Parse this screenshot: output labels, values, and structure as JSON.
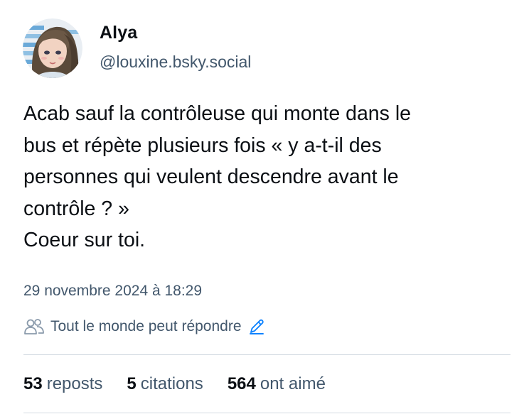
{
  "author": {
    "display_name": "Alya",
    "handle": "@louxine.bsky.social"
  },
  "post": {
    "lines": [
      "Acab sauf la contrôleuse qui monte dans le",
      "bus et répète plusieurs fois « y a-t-il des",
      "personnes qui veulent descendre avant le",
      "contrôle ? »",
      "Coeur sur toi."
    ],
    "timestamp": "29 novembre 2024 à 18:29",
    "reply_setting": "Tout le monde peut répondre"
  },
  "stats": {
    "reposts_count": "53",
    "reposts_label": "reposts",
    "quotes_count": "5",
    "quotes_label": "citations",
    "likes_count": "564",
    "likes_label": "ont aimé"
  },
  "icons": {
    "people": "people-icon",
    "edit": "pencil-icon"
  },
  "colors": {
    "text_primary": "#0b0f14",
    "text_secondary": "#42576c",
    "accent": "#1083fe",
    "divider": "#d4dbe2"
  }
}
